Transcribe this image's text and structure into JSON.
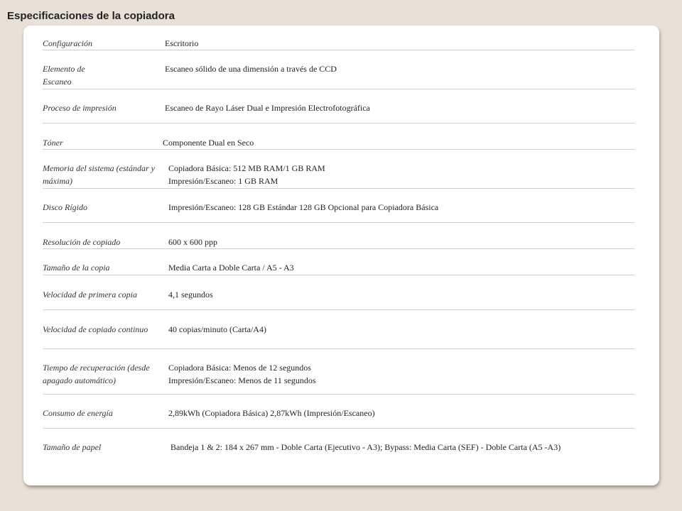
{
  "page_title": "Especificaciones de la copiadora",
  "specs": [
    {
      "label": "Configuración",
      "value": [
        "Escritorio"
      ]
    },
    {
      "label": "Elemento de Escaneo",
      "value": [
        "Escaneo sólido de una dimensión a través de CCD"
      ]
    },
    {
      "label": "Proceso de impresión",
      "value": [
        "Escaneo de Rayo Láser Dual e Impresión Electrofotográfica"
      ]
    },
    {
      "label": "Tóner",
      "value": [
        "Componente Dual en Seco"
      ]
    },
    {
      "label": "Memoria del sistema (estándar y máxima)",
      "value": [
        "Copiadora Básica: 512 MB RAM/1 GB RAM",
        "Impresión/Escaneo: 1 GB RAM"
      ]
    },
    {
      "label": "Disco Rígido",
      "value": [
        "Impresión/Escaneo: 128 GB Estándar 128 GB Opcional para Copiadora Básica"
      ]
    },
    {
      "label": "Resolución de copiado",
      "value": [
        "600 x 600 ppp"
      ]
    },
    {
      "label": "Tamaño de la copia",
      "value": [
        "Media Carta a Doble Carta / A5 - A3"
      ]
    },
    {
      "label": "Velocidad de primera copia",
      "value": [
        "4,1 segundos"
      ]
    },
    {
      "label": "Velocidad de copiado continuo",
      "value": [
        "40 copias/minuto (Carta/A4)"
      ]
    },
    {
      "label": "Tiempo de recuperación (desde apagado automático)",
      "value": [
        "Copiadora Básica: Menos de 12 segundos",
        "Impresión/Escaneo: Menos de 11 segundos"
      ]
    },
    {
      "label": "Consumo de energía",
      "value": [
        "2,89kWh (Copiadora Básica) 2,87kWh (Impresión/Escaneo)"
      ]
    },
    {
      "label": "Tamaño de papel",
      "value": [
        "Bandeja 1 & 2: 184 x 267 mm - Doble Carta (Ejecutivo - A3); Bypass: Media Carta (SEF) - Doble Carta (A5 -A3)"
      ]
    }
  ]
}
